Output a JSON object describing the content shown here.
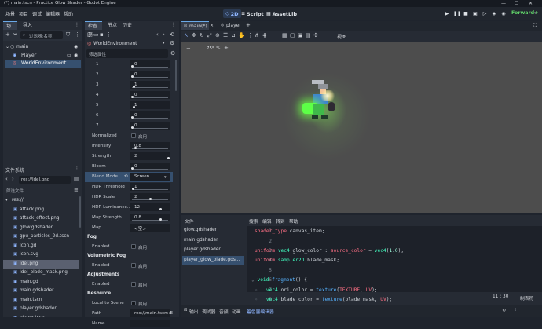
{
  "window": {
    "title": "(*) main.tscn - Practice Glow Shader - Godot Engine",
    "controls": [
      "—",
      "☐",
      "✕"
    ]
  },
  "menu": [
    "场景",
    "项目",
    "调试",
    "编辑器",
    "帮助"
  ],
  "workspaces": [
    {
      "icon": "◇",
      "label": "2D"
    },
    {
      "icon": "≡",
      "label": "Script"
    },
    {
      "icon": "▦",
      "label": "AssetLib"
    }
  ],
  "renderer": "Forward+",
  "scene_panel": {
    "tabs": [
      "场景",
      "导入"
    ],
    "filter_placeholder": "过滤器:名称,",
    "tree": [
      {
        "name": "main",
        "icon": "○",
        "depth": 0
      },
      {
        "name": "Player",
        "icon": "◉",
        "depth": 1
      },
      {
        "name": "WorldEnvironment",
        "icon": "◎",
        "depth": 1,
        "selected": true
      }
    ]
  },
  "filesystem": {
    "title": "文件系统",
    "path": "res://Idel.png",
    "filter_placeholder": "筛选文件",
    "items": [
      {
        "name": "res://",
        "icon": "▾",
        "indent": 0
      },
      {
        "name": "attack.png",
        "icon": "▣",
        "indent": 1
      },
      {
        "name": "attack_effect.png",
        "icon": "▣",
        "indent": 1
      },
      {
        "name": "glow.gdshader",
        "icon": "▣",
        "indent": 1
      },
      {
        "name": "gpu_particles_2d.tscn",
        "icon": "▣",
        "indent": 1
      },
      {
        "name": "Icon.gd",
        "icon": "▣",
        "indent": 1
      },
      {
        "name": "icon.svg",
        "icon": "▣",
        "indent": 1
      },
      {
        "name": "Idel.png",
        "icon": "▣",
        "indent": 1,
        "selected": true
      },
      {
        "name": "Idel_blade_mask.png",
        "icon": "▣",
        "indent": 1
      },
      {
        "name": "main.gd",
        "icon": "▣",
        "indent": 1
      },
      {
        "name": "main.gdshader",
        "icon": "▣",
        "indent": 1
      },
      {
        "name": "main.tscn",
        "icon": "▣",
        "indent": 1
      },
      {
        "name": "player.gdshader",
        "icon": "▣",
        "indent": 1
      },
      {
        "name": "player.tscn",
        "icon": "▣",
        "indent": 1
      }
    ]
  },
  "inspector": {
    "tabs": [
      "检查器",
      "节点",
      "历史"
    ],
    "object": "WorldEnvironment",
    "filter_placeholder": "筛选属性",
    "levels": [
      {
        "label": "1",
        "value": "0",
        "fraction": 0.0
      },
      {
        "label": "2",
        "value": "0",
        "fraction": 0.0
      },
      {
        "label": "3",
        "value": "1",
        "fraction": 0.06
      },
      {
        "label": "4",
        "value": "0",
        "fraction": 0.0
      },
      {
        "label": "5",
        "value": "1",
        "fraction": 0.06
      },
      {
        "label": "6",
        "value": "0",
        "fraction": 0.0
      },
      {
        "label": "7",
        "value": "0",
        "fraction": 0.0
      }
    ],
    "normalized": {
      "label": "Normalized",
      "text": "启用"
    },
    "sliders": [
      {
        "label": "Intensity",
        "value": "0.8",
        "fraction": 0.1
      },
      {
        "label": "Strength",
        "value": "2",
        "fraction": 1.0
      },
      {
        "label": "Bloom",
        "value": "0",
        "fraction": 0.0
      }
    ],
    "blend_mode": {
      "label": "Blend Mode",
      "value": "Screen"
    },
    "hdr": [
      {
        "label": "HDR Threshold",
        "value": "1",
        "fraction": 0.03
      },
      {
        "label": "HDR Scale",
        "value": "2",
        "fraction": 0.5
      },
      {
        "label": "HDR Luminance…",
        "value": "12",
        "fraction": 0.8
      },
      {
        "label": "Map Strength",
        "value": "0.8",
        "fraction": 0.8
      }
    ],
    "map": {
      "label": "Map",
      "value": "<空>"
    },
    "fog": {
      "title": "Fog",
      "label": "Enabled",
      "text": "启用"
    },
    "vfog": {
      "title": "Volumetric Fog",
      "label": "Enabled",
      "text": "启用"
    },
    "adjust": {
      "title": "Adjustments",
      "label": "Enabled",
      "text": "启用"
    },
    "resource": {
      "title": "Resource",
      "local_label": "Local to Scene",
      "local_text": "启用",
      "path_label": "Path",
      "path_value": "res://main.tscn::E",
      "name_label": "Name"
    }
  },
  "editor_tabs": [
    {
      "label": "main(*)",
      "selected": true
    },
    {
      "label": "player",
      "selected": false
    }
  ],
  "zoom": "755 %",
  "toolbar_view": "视图",
  "script_panel": {
    "menu": [
      "文件",
      "搜索",
      "编辑",
      "转到",
      "帮助"
    ],
    "files": [
      {
        "name": "glow.gdshader",
        "selected": false
      },
      {
        "name": "main.gdshader",
        "selected": false
      },
      {
        "name": "player.gdshader",
        "selected": false
      },
      {
        "name": "player_glow_blade.gds...",
        "selected": true
      }
    ],
    "line_numbers": [
      "1",
      "2",
      "3",
      "4",
      "5",
      "6",
      "7",
      "8"
    ],
    "cursor": "11 : 30",
    "indent_mode": "制表符"
  },
  "bottom_tabs": [
    "输出",
    "调试器",
    "音频",
    "动画",
    "着色器编辑器"
  ],
  "colors": {
    "accent": "#6aa9e8",
    "selection": "#36506f",
    "keyword": "#ff7085",
    "type": "#42ffc2",
    "function": "#57b3ff",
    "number": "#a1ffe0",
    "glow": "#8cff5a"
  }
}
